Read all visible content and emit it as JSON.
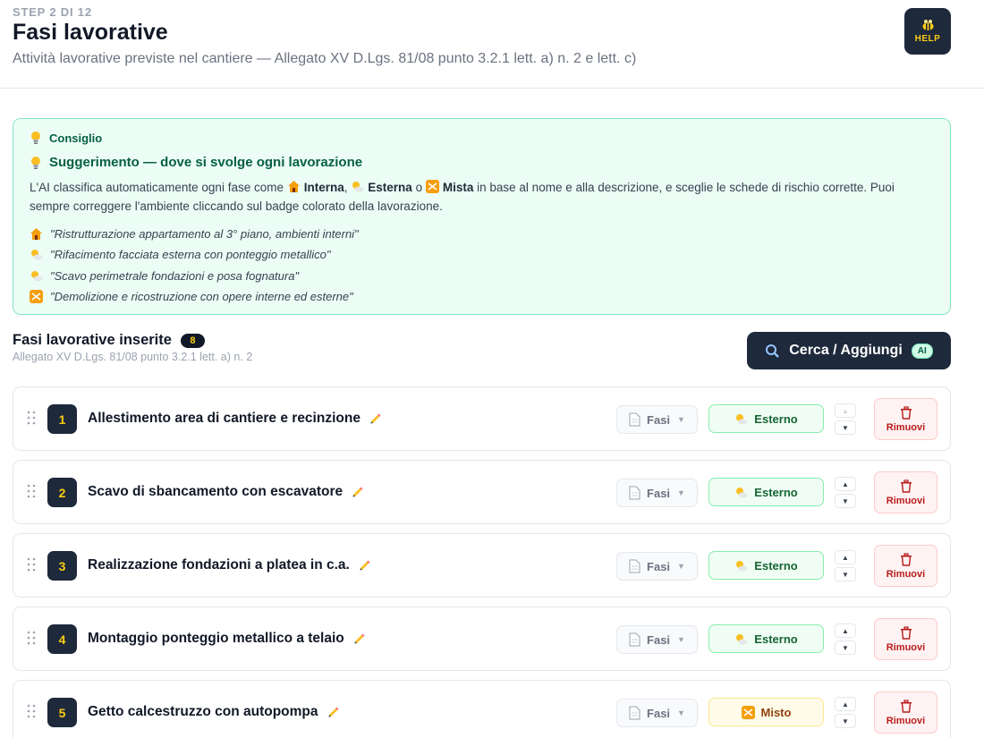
{
  "header": {
    "step": "STEP 2 DI 12",
    "title": "Fasi lavorative",
    "subtitle": "Attività lavorative previste nel cantiere — Allegato XV D.Lgs. 81/08 punto 3.2.1 lett. a) n. 2 e lett. c)",
    "help_label": "HELP"
  },
  "tip": {
    "head": "Consiglio",
    "title": "Suggerimento — dove si svolge ogni lavorazione",
    "body_prefix": "L'AI classifica automaticamente ogni fase come",
    "interna": "Interna",
    "esterna": "Esterna",
    "mista": "Mista",
    "sep1": ",",
    "sep2": "o",
    "body_suffix": "in base al nome e alla descrizione, e sceglie le schede di rischio corrette. Puoi sempre correggere l'ambiente cliccando sul badge colorato della lavorazione.",
    "examples": [
      {
        "icon": "house-icon",
        "text": "\"Ristrutturazione appartamento al 3° piano, ambienti interni\""
      },
      {
        "icon": "sun-cloud-icon",
        "text": "\"Rifacimento facciata esterna con ponteggio metallico\""
      },
      {
        "icon": "sun-cloud-icon",
        "text": "\"Scavo perimetrale fondazioni e posa fognatura\""
      },
      {
        "icon": "shuffle-icon",
        "text": "\"Demolizione e ricostruzione con opere interne ed esterne\""
      }
    ]
  },
  "section": {
    "title": "Fasi lavorative inserite",
    "count": "8",
    "subtitle": "Allegato XV D.Lgs. 81/08 punto 3.2.1 lett. a) n. 2",
    "search_label": "Cerca / Aggiungi",
    "ai_badge": "AI"
  },
  "rows": [
    {
      "num": "1",
      "name": "Allestimento area di cantiere e recinzione",
      "fasi": "Fasi",
      "env": "Esterno",
      "env_type": "ext",
      "remove": "Rimuovi"
    },
    {
      "num": "2",
      "name": "Scavo di sbancamento con escavatore",
      "fasi": "Fasi",
      "env": "Esterno",
      "env_type": "ext",
      "remove": "Rimuovi"
    },
    {
      "num": "3",
      "name": "Realizzazione fondazioni a platea in c.a.",
      "fasi": "Fasi",
      "env": "Esterno",
      "env_type": "ext",
      "remove": "Rimuovi"
    },
    {
      "num": "4",
      "name": "Montaggio ponteggio metallico a telaio",
      "fasi": "Fasi",
      "env": "Esterno",
      "env_type": "ext",
      "remove": "Rimuovi"
    },
    {
      "num": "5",
      "name": "Getto calcestruzzo con autopompa",
      "fasi": "Fasi",
      "env": "Misto",
      "env_type": "mix",
      "remove": "Rimuovi"
    }
  ],
  "colors": {
    "dark": "#1e293b",
    "accent_yellow": "#facc15",
    "tip_bg": "#ecfdf5",
    "tip_border": "#86e6c2",
    "ext_border": "#86efac",
    "mix_border": "#fde68a",
    "remove_red": "#b91c1c"
  }
}
